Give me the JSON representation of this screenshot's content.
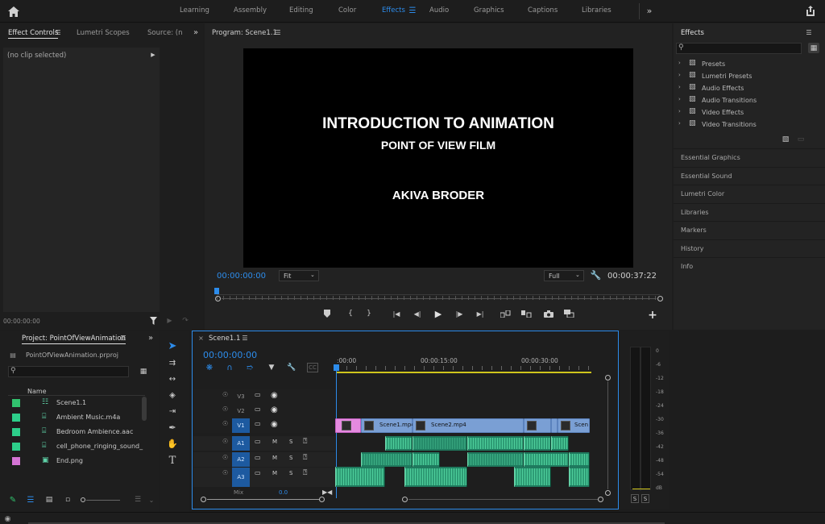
{
  "workspaces": [
    "Learning",
    "Assembly",
    "Editing",
    "Color",
    "Effects",
    "Audio",
    "Graphics",
    "Captions",
    "Libraries"
  ],
  "active_workspace": "Effects",
  "effect_controls": {
    "tabs": [
      "Effect Controls",
      "Lumetri Scopes",
      "Source: (n"
    ],
    "no_clip": "(no clip selected)",
    "timecode": "00:00:00:00"
  },
  "program": {
    "title": "Program: Scene1.1",
    "screen_title": "INTRODUCTION TO ANIMATION",
    "screen_subtitle": "POINT OF VIEW FILM",
    "screen_author": "AKIVA BRODER",
    "timecode": "00:00:00:00",
    "fit": "Fit",
    "quality": "Full",
    "duration": "00:00:37:22"
  },
  "effects_panel": {
    "title": "Effects",
    "folders": [
      "Presets",
      "Lumetri Presets",
      "Audio Effects",
      "Audio Transitions",
      "Video Effects",
      "Video Transitions"
    ],
    "sections": [
      "Essential Graphics",
      "Essential Sound",
      "Lumetri Color",
      "Libraries",
      "Markers",
      "History",
      "Info"
    ]
  },
  "project": {
    "title": "Project: PointOfViewAnimation",
    "file": "PointOfViewAnimation.prproj",
    "column": "Name",
    "items": [
      {
        "name": "Scene1.1",
        "color": "#31c36e"
      },
      {
        "name": "Ambient Music.m4a",
        "color": "#2dce8a"
      },
      {
        "name": "Bedroom Ambience.aac",
        "color": "#2dce8a"
      },
      {
        "name": "cell_phone_ringing_sound_",
        "color": "#2dce8a"
      },
      {
        "name": "End.png",
        "color": "#d474d4"
      }
    ]
  },
  "timeline": {
    "tab": "Scene1.1",
    "timecode": "00:00:00:00",
    "ruler": [
      ":00:00",
      "00:00:15:00",
      "00:00:30:00"
    ],
    "video_tracks": [
      "V3",
      "V2",
      "V1"
    ],
    "audio_tracks": [
      "A1",
      "A2",
      "A3"
    ],
    "mix_label": "Mix",
    "mix_value": "0.0",
    "clips": [
      "Scene1.mp4",
      "Scene2.mp4",
      "Scen"
    ],
    "track_letters": {
      "mute": "M",
      "solo": "S"
    }
  },
  "meter": {
    "scale": [
      "0",
      "-6",
      "-12",
      "-18",
      "-24",
      "-30",
      "-36",
      "-42",
      "-48",
      "-54",
      "dB"
    ],
    "solo": [
      "S",
      "S"
    ]
  },
  "colors": {
    "accent": "#2d8ceb",
    "audio": "#1f7a5e",
    "video": "#7a9fd4",
    "graphic": "#e58ae0"
  }
}
